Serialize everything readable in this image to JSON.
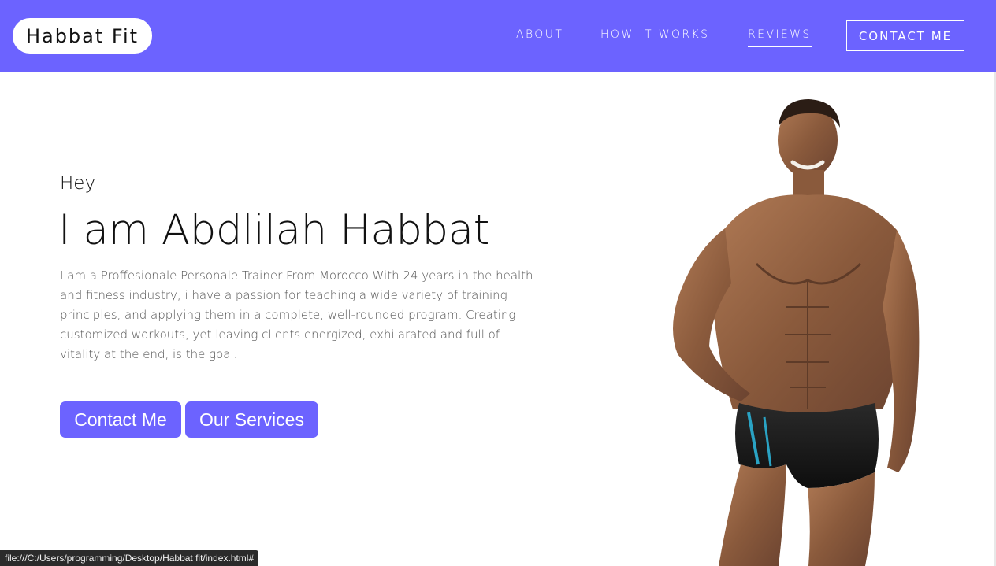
{
  "navbar": {
    "logo": "Habbat Fit",
    "links": [
      {
        "label": "ABOUT"
      },
      {
        "label": "HOW IT WORKS"
      },
      {
        "label": "REVIEWS",
        "active": true
      }
    ],
    "contact_button": "CONTACT ME"
  },
  "hero": {
    "greeting": "Hey",
    "name": "I am Abdlilah Habbat",
    "bio": "I am a Proffesionale Personale Trainer From Morocco With 24 years in the health and fitness industry, i have a passion for teaching a wide variety of training principles, and applying them in a complete, well-rounded program. Creating customized workouts, yet leaving clients energized, exhilarated and full of vitality at the end, is the goal.",
    "buttons": {
      "contact": "Contact Me",
      "services": "Our Services"
    }
  },
  "status_bar": {
    "url": "file:///C:/Users/programming/Desktop/Habbat fit/index.html#"
  },
  "colors": {
    "accent": "#6c63ff",
    "text": "#111111",
    "muted_text": "#555555"
  }
}
